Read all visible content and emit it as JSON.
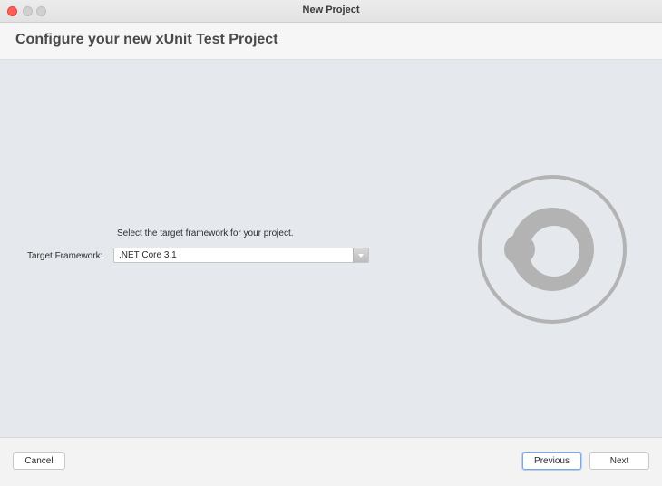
{
  "window": {
    "title": "New Project"
  },
  "header": {
    "title": "Configure your new xUnit Test Project"
  },
  "main": {
    "instruction": "Select the target framework for your project.",
    "framework_label": "Target Framework:",
    "framework_selected": ".NET Core 3.1",
    "logo_icon": "project-logo-icon",
    "logo_color": "#b3b3b3",
    "background_color": "#e5e8ec"
  },
  "footer": {
    "cancel_label": "Cancel",
    "previous_label": "Previous",
    "next_label": "Next"
  }
}
